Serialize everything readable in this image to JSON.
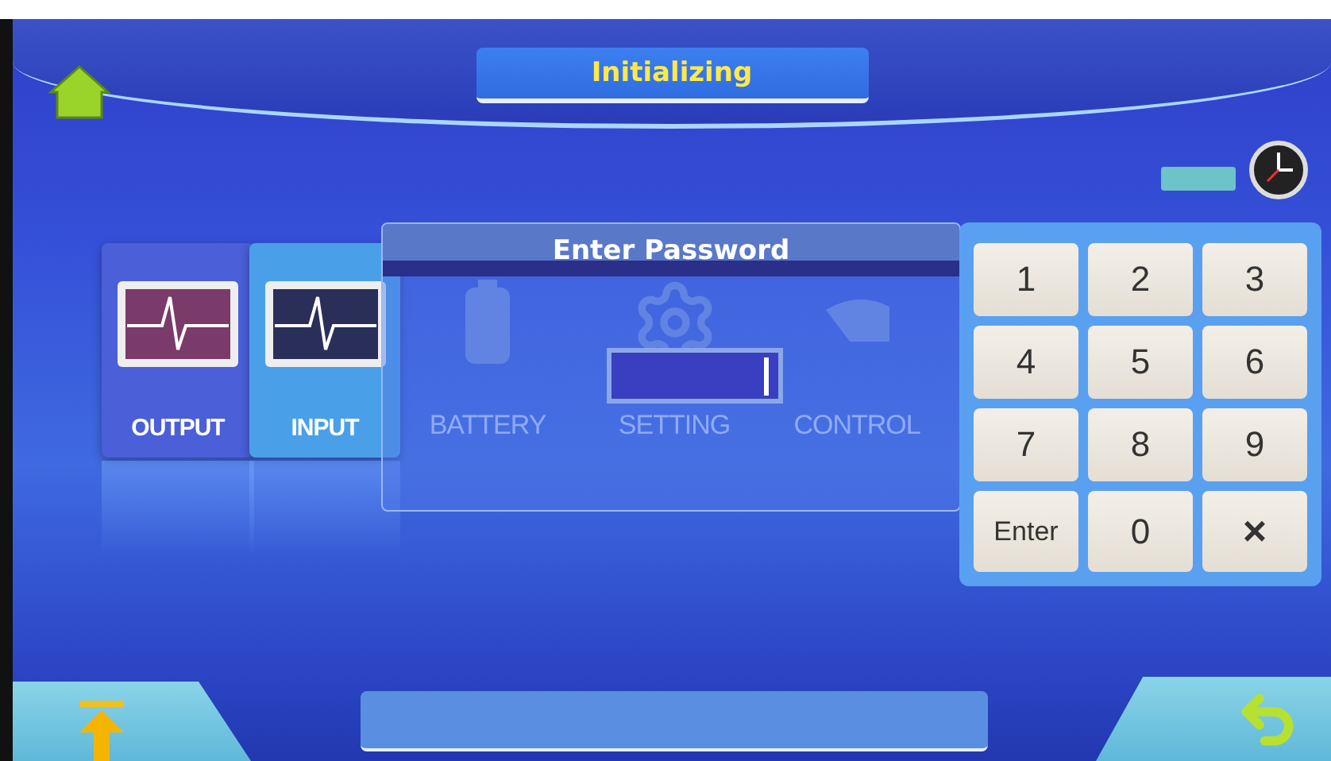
{
  "header": {
    "title": "Initializing"
  },
  "menu_cards": [
    {
      "label": "OUTPUT",
      "kind": "monitor",
      "color": "#7a3a6a"
    },
    {
      "label": "INPUT",
      "kind": "monitor",
      "color": "#2a2f5a"
    },
    {
      "label": "BATTERY",
      "kind": "battery"
    },
    {
      "label": "SETTING",
      "kind": "gear"
    },
    {
      "label": "CONTROL",
      "kind": "control"
    }
  ],
  "password_dialog": {
    "title": "Enter Password"
  },
  "keypad": {
    "keys": [
      {
        "label": "1",
        "kind": "digit"
      },
      {
        "label": "2",
        "kind": "digit"
      },
      {
        "label": "3",
        "kind": "digit"
      },
      {
        "label": "4",
        "kind": "digit"
      },
      {
        "label": "5",
        "kind": "digit"
      },
      {
        "label": "6",
        "kind": "digit"
      },
      {
        "label": "7",
        "kind": "digit"
      },
      {
        "label": "8",
        "kind": "digit"
      },
      {
        "label": "9",
        "kind": "digit"
      },
      {
        "label": "Enter",
        "kind": "enter"
      },
      {
        "label": "0",
        "kind": "digit"
      },
      {
        "label": "×",
        "kind": "clear"
      }
    ]
  }
}
